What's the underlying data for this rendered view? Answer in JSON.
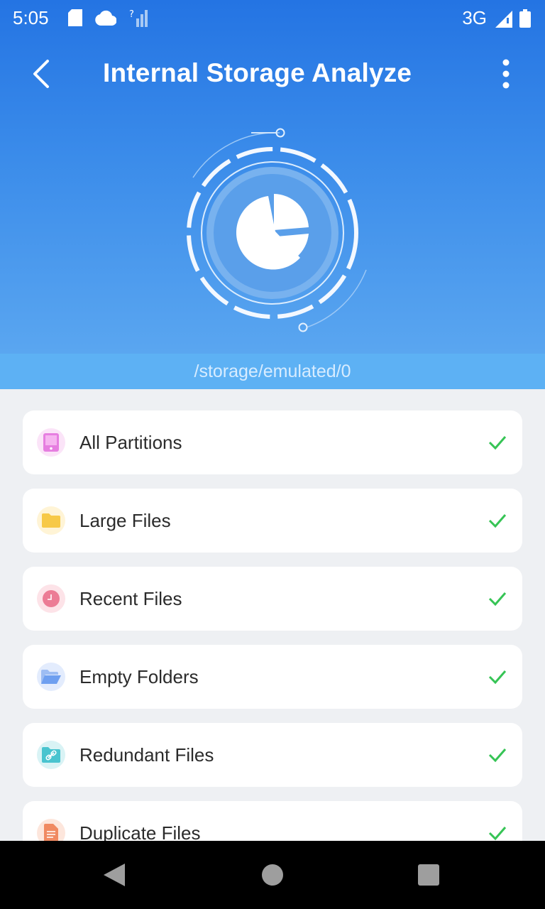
{
  "status_bar": {
    "time": "5:05",
    "network": "3G"
  },
  "app_bar": {
    "title": "Internal Storage Analyze"
  },
  "path": "/storage/emulated/0",
  "items": [
    {
      "label": "All Partitions",
      "icon": "phone-icon",
      "icon_bg": "#fbe4f8",
      "icon_color": "#e67ee0"
    },
    {
      "label": "Large Files",
      "icon": "folder-icon",
      "icon_bg": "#fff4d6",
      "icon_color": "#f7c947"
    },
    {
      "label": "Recent Files",
      "icon": "clock-icon",
      "icon_bg": "#fde3e8",
      "icon_color": "#ec7c95"
    },
    {
      "label": "Empty Folders",
      "icon": "open-folder-icon",
      "icon_bg": "#e3ecfd",
      "icon_color": "#6e9ff0"
    },
    {
      "label": "Redundant Files",
      "icon": "link-icon",
      "icon_bg": "#d9f3f5",
      "icon_color": "#49c4cf"
    },
    {
      "label": "Duplicate Files",
      "icon": "document-icon",
      "icon_bg": "#fde6dc",
      "icon_color": "#f08a62"
    }
  ],
  "colors": {
    "accent": "#2474e3",
    "check": "#36c455"
  }
}
